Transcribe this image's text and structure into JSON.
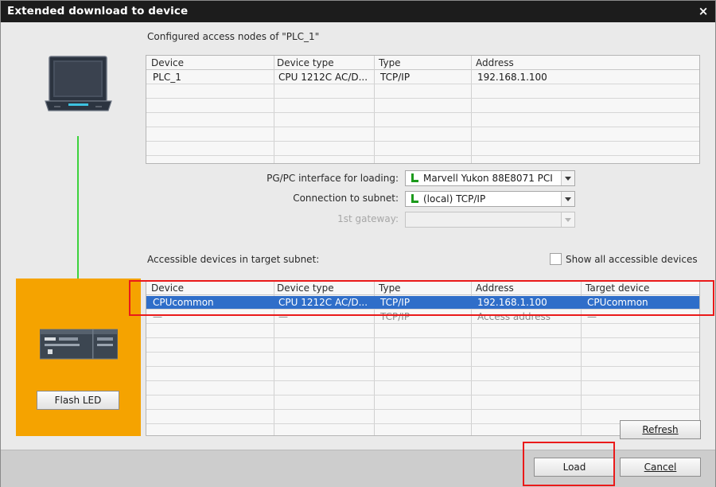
{
  "window": {
    "title": "Extended download to device",
    "close_glyph": "×"
  },
  "configured": {
    "title": "Configured access nodes of \"PLC_1\"",
    "columns": [
      "Device",
      "Device type",
      "Type",
      "Address"
    ],
    "rows": [
      [
        "PLC_1",
        "CPU 1212C AC/D...",
        "TCP/IP",
        "192.168.1.100"
      ]
    ]
  },
  "settings": {
    "pg_pc_label": "PG/PC interface for loading:",
    "pg_pc_value": "Marvell Yukon 88E8071 PCI",
    "subnet_label": "Connection to subnet:",
    "subnet_value": "(local) TCP/IP",
    "gateway_label": "1st gateway:",
    "gateway_value": ""
  },
  "accessible": {
    "title": "Accessible devices in target subnet:",
    "show_all_label": "Show all accessible devices",
    "show_all_checked": false,
    "columns": [
      "Device",
      "Device type",
      "Type",
      "Address",
      "Target device"
    ],
    "rows": [
      [
        "CPUcommon",
        "CPU 1212C AC/D...",
        "TCP/IP",
        "192.168.1.100",
        "CPUcommon"
      ],
      [
        "—",
        "—",
        "TCP/IP",
        "Access address",
        "—"
      ]
    ]
  },
  "device_panel": {
    "flash_led_label": "Flash LED",
    "background": "#f5a300"
  },
  "buttons": {
    "refresh_label": "Refresh",
    "load_label": "Load",
    "cancel_label": "Cancel"
  },
  "colors": {
    "titlebar": "#1c1c1c",
    "selection": "#2f6ec9",
    "connection_line": "#3dd23d",
    "highlight": "#ea1a1a"
  }
}
